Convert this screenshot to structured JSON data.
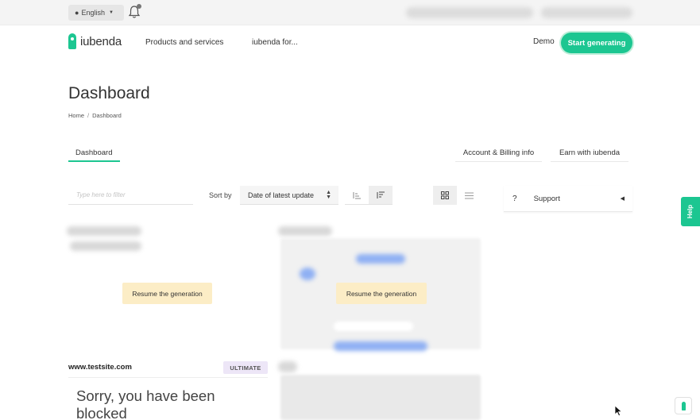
{
  "topbar": {
    "language": "English",
    "language_icon": "globe-icon",
    "notification_icon": "bell-icon"
  },
  "nav": {
    "brand": "iubenda",
    "links": [
      "Products and services",
      "iubenda for..."
    ],
    "demo": "Demo",
    "cta": "Start generating"
  },
  "page": {
    "title": "Dashboard",
    "breadcrumb": [
      "Home",
      "Dashboard"
    ]
  },
  "tabs": {
    "active": "Dashboard",
    "right": [
      "Account & Billing info",
      "Earn with iubenda"
    ]
  },
  "filters": {
    "search_placeholder": "Type here to filter",
    "sort_label": "Sort by",
    "sort_value": "Date of latest update"
  },
  "support": {
    "icon": "?",
    "label": "Support"
  },
  "help_tab": "Help",
  "cards": {
    "resume_label": "Resume the generation",
    "site": "www.testsite.com",
    "plan_badge": "ULTIMATE",
    "blocked_message": "Sorry, you have been blocked"
  },
  "colors": {
    "brand_green": "#1cc691",
    "resume_bg": "#fcedc6",
    "badge_bg": "#ede6f7"
  }
}
